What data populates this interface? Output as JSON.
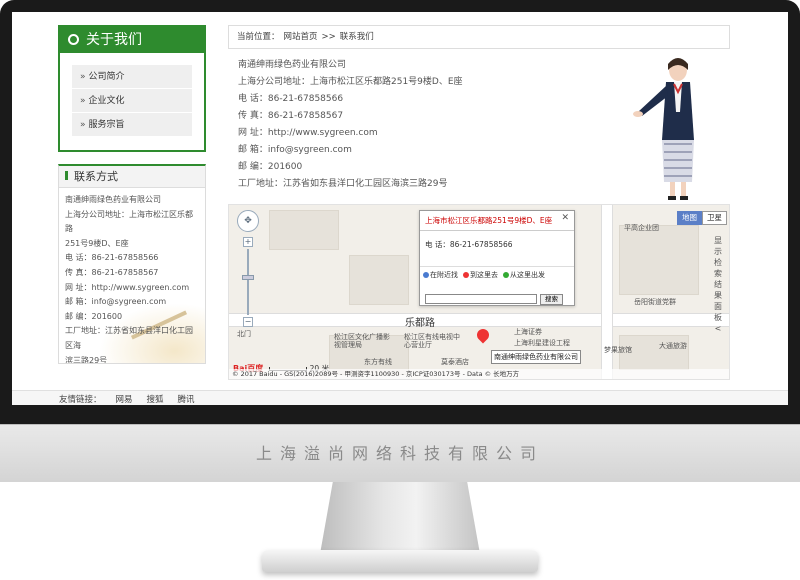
{
  "about": {
    "title": "关于我们",
    "items": [
      "公司简介",
      "企业文化",
      "服务宗旨"
    ]
  },
  "contact": {
    "title": "联系方式",
    "lines": [
      "南通绅雨绿色药业有限公司",
      "上海分公司地址：上海市松江区乐都路",
      "251号9楼D、E座",
      "电 话：86-21-67858566",
      "传 真：86-21-67858567",
      "网 址：http://www.sygreen.com",
      "邮 箱：info@sygreen.com",
      "邮 编：201600",
      "工厂地址：江苏省如东县洋口化工园区海",
      "滨三路29号"
    ]
  },
  "breadcrumb": {
    "prefix": "当前位置：",
    "home": "网站首页",
    "sep": ">>",
    "current": "联系我们"
  },
  "info": [
    "南通绅雨绿色药业有限公司",
    "上海分公司地址：上海市松江区乐都路251号9楼D、E座",
    "电 话：86-21-67858566",
    "传 真：86-21-67858567",
    "网 址：http://www.sygreen.com",
    "邮 箱：info@sygreen.com",
    "邮 编：201600",
    "工厂地址：江苏省如东县洋口化工园区海滨三路29号"
  ],
  "map": {
    "popup_title": "上海市松江区乐都路251号9楼D、E座",
    "popup_close": "✕",
    "popup_phone": "电 话：86-21-67858566",
    "tab_nearby": "在附近找",
    "tab_to_here": "到这里去",
    "tab_from_here": "从这里出发",
    "search_button": "搜索",
    "type_map": "地图",
    "type_satellite": "卫星",
    "side_panel": [
      "显",
      "示",
      "检",
      "索",
      "结",
      "果",
      "面",
      "板",
      "<"
    ],
    "road_name": "乐都路",
    "marker_label": "南通绅雨绿色药业有限公司",
    "scale_logo": "Bai百度",
    "scale_text": "20 米",
    "copyright": "© 2017 Baidu - GS(2016)2089号 - 甲测资字1100930 - 京ICP证030173号 - Data © 长地万方",
    "places": [
      "平高企业团",
      "岳阳街道党群",
      "松江区文化广播影视管理局",
      "松江区有线电视中心营业厅",
      "上海证券",
      "上海利星建设工程",
      "梦果旅馆",
      "大通旅游",
      "东方有线",
      "莫泰酒店",
      "北门"
    ]
  },
  "footer": {
    "links_label": "友情链接：",
    "links": [
      "网易",
      "搜狐",
      "腾讯"
    ]
  },
  "monitor": {
    "brand": "上海溢尚网络科技有限公司"
  },
  "colors": {
    "accent_green": "#2e8b2e",
    "map_bg": "#f2efe9",
    "pin": "#e33333"
  }
}
